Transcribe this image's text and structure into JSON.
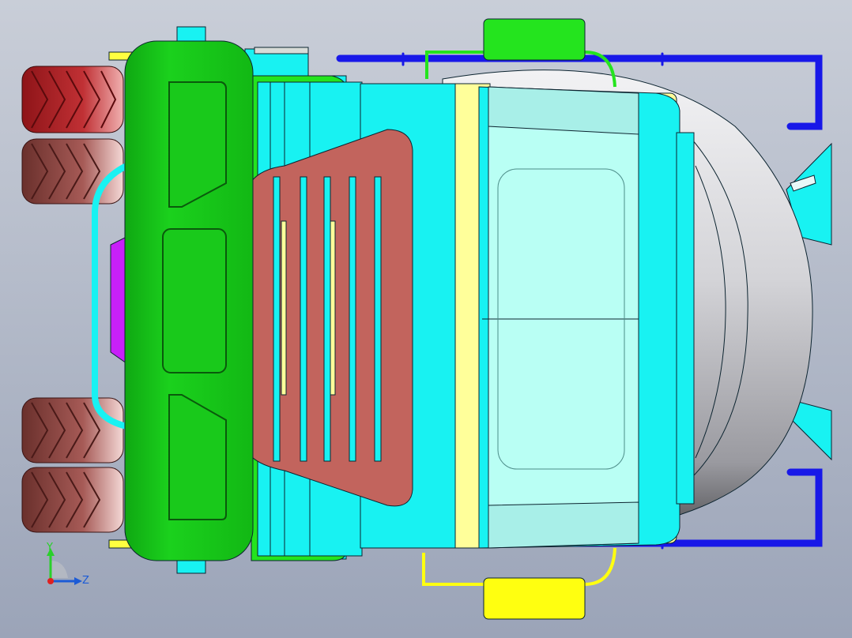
{
  "viewport": {
    "background_top": "#c9ced8",
    "background_bottom": "#9ba4b8"
  },
  "model": {
    "name": "concrete-mixer-truck",
    "view": "top-orthographic",
    "colors": {
      "bumper_green": "#19c91b",
      "bumper_dark": "#0a8f0e",
      "cab_cyan": "#18f2f2",
      "windshield": "#b9fff4",
      "cab_yellow": "#ffff9a",
      "grille_red": "#c2645d",
      "tire_red": "#b8262a",
      "tire_brown": "#9a5450",
      "drum_gray": "#d4d4d8",
      "rail_blue": "#1818e8",
      "tank_yellow": "#ffff10",
      "tank_green": "#24e41e",
      "purple": "#c820f8",
      "edge": "#0c2430"
    }
  },
  "triad": {
    "y_label": "Y",
    "z_label": "Z",
    "x_icon": "origin-point-icon"
  }
}
